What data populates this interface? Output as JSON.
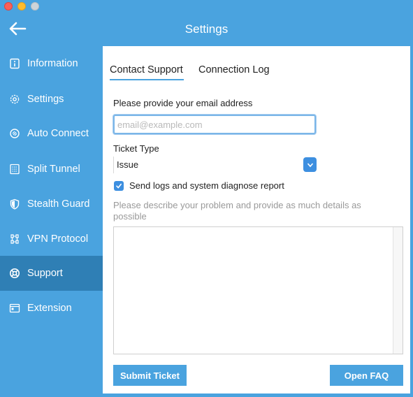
{
  "window": {
    "title": "Settings"
  },
  "sidebar": {
    "items": [
      {
        "label": "Information",
        "icon": "info-icon"
      },
      {
        "label": "Settings",
        "icon": "gear-icon"
      },
      {
        "label": "Auto Connect",
        "icon": "auto-connect-icon"
      },
      {
        "label": "Split Tunnel",
        "icon": "split-tunnel-icon"
      },
      {
        "label": "Stealth Guard",
        "icon": "shield-icon"
      },
      {
        "label": "VPN Protocol",
        "icon": "protocol-icon"
      },
      {
        "label": "Support",
        "icon": "lifebuoy-icon",
        "active": true
      },
      {
        "label": "Extension",
        "icon": "extension-icon"
      }
    ]
  },
  "tabs": {
    "contact": "Contact Support",
    "log": "Connection Log"
  },
  "form": {
    "email_label": "Please provide your email address",
    "email_placeholder": "email@example.com",
    "email_value": "",
    "ticket_type_label": "Ticket Type",
    "ticket_type_value": "Issue",
    "send_logs_label": "Send logs and system diagnose report",
    "send_logs_checked": true,
    "description_hint": "Please describe your problem and provide as much details as possible",
    "description_value": ""
  },
  "buttons": {
    "submit": "Submit Ticket",
    "faq": "Open FAQ"
  },
  "colors": {
    "accent": "#4aa3df",
    "sidebar_active": "#2f7fb5",
    "checkbox": "#3d8fe0"
  }
}
